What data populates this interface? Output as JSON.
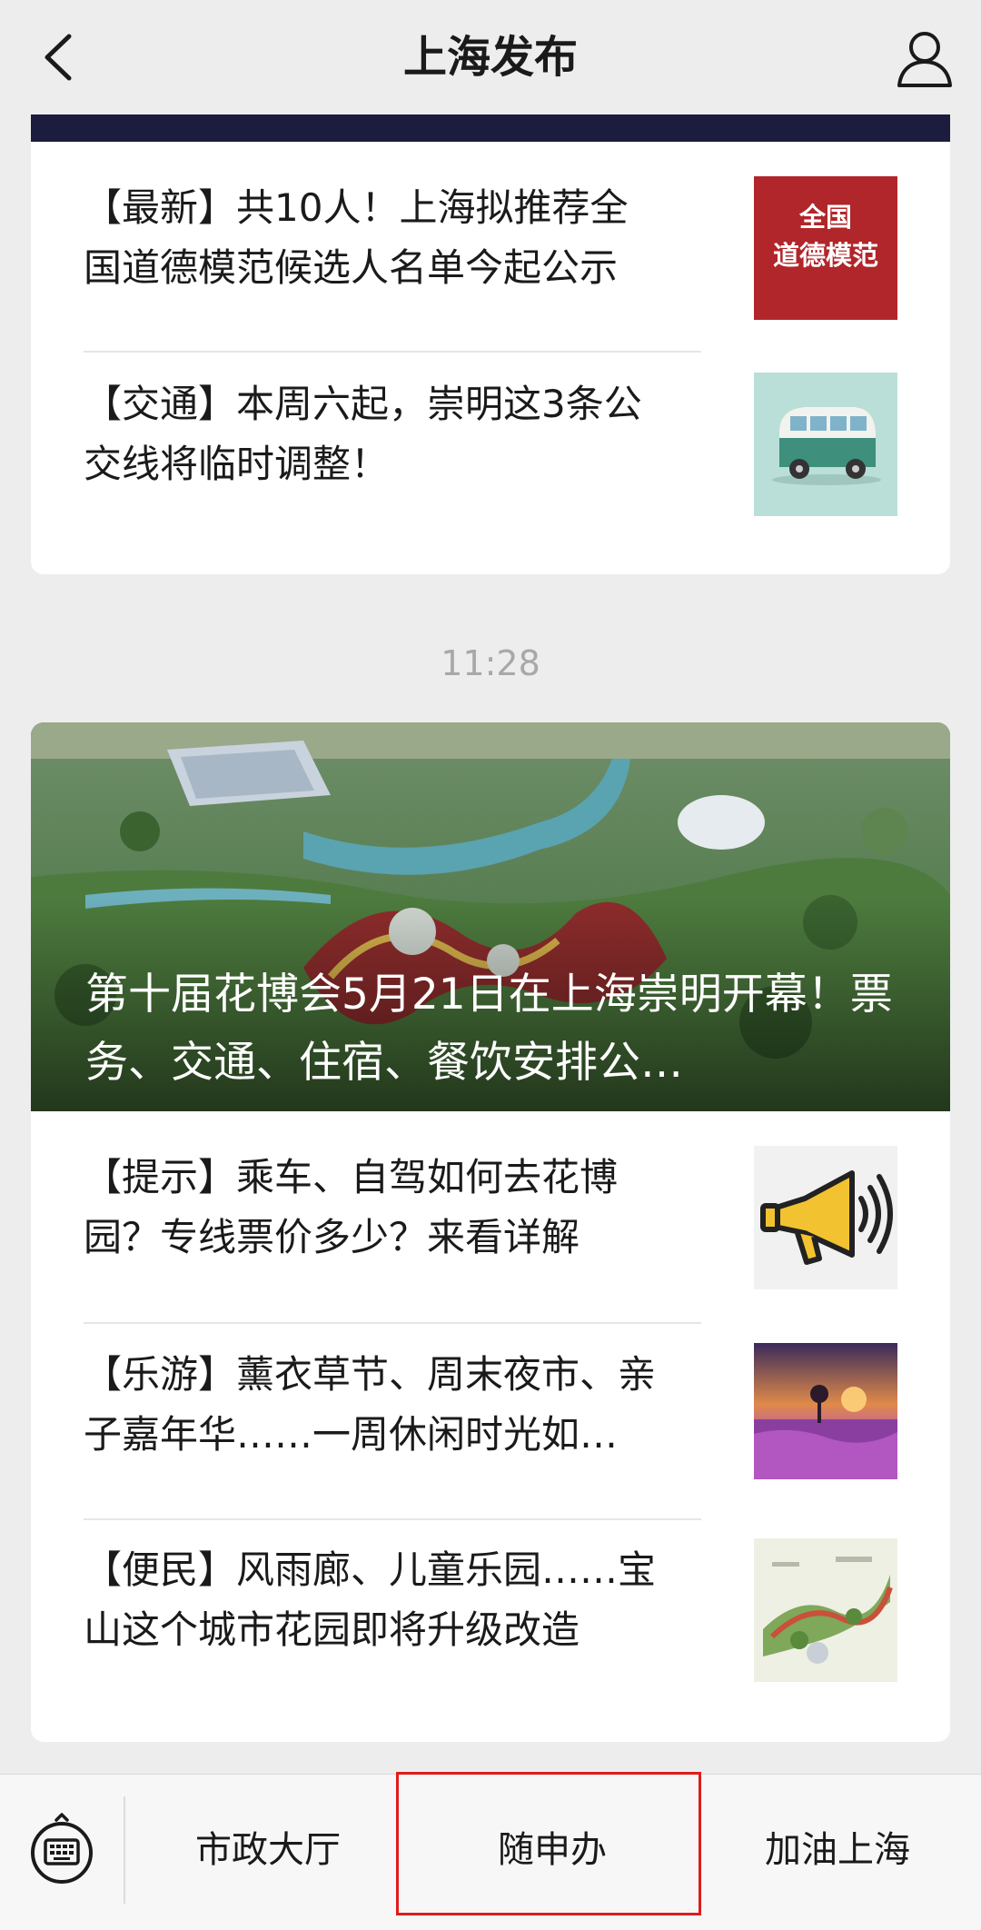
{
  "header": {
    "title": "上海发布"
  },
  "articles_top": [
    {
      "text": "【最新】共10人！上海拟推荐全国道德模范候选人名单今起公示",
      "thumb_text": "全国\n道德模范"
    },
    {
      "text": "【交通】本周六起，崇明这3条公交线将临时调整！"
    }
  ],
  "timestamp": "11:28",
  "hero": {
    "title": "第十届花博会5月21日在上海崇明开幕！票务、交通、住宿、餐饮安排公…"
  },
  "articles_bottom": [
    {
      "text": "【提示】乘车、自驾如何去花博园？专线票价多少？来看详解"
    },
    {
      "text": "【乐游】薰衣草节、周末夜市、亲子嘉年华……一周休闲时光如…"
    },
    {
      "text": "【便民】风雨廊、儿童乐园……宝山这个城市花园即将升级改造"
    }
  ],
  "bottom_menu": [
    {
      "label": "市政大厅"
    },
    {
      "label": "随申办"
    },
    {
      "label": "加油上海"
    }
  ],
  "colors": {
    "highlight": "#e01c1c",
    "header_bg": "#ededed",
    "strip": "#1b1c3e"
  }
}
